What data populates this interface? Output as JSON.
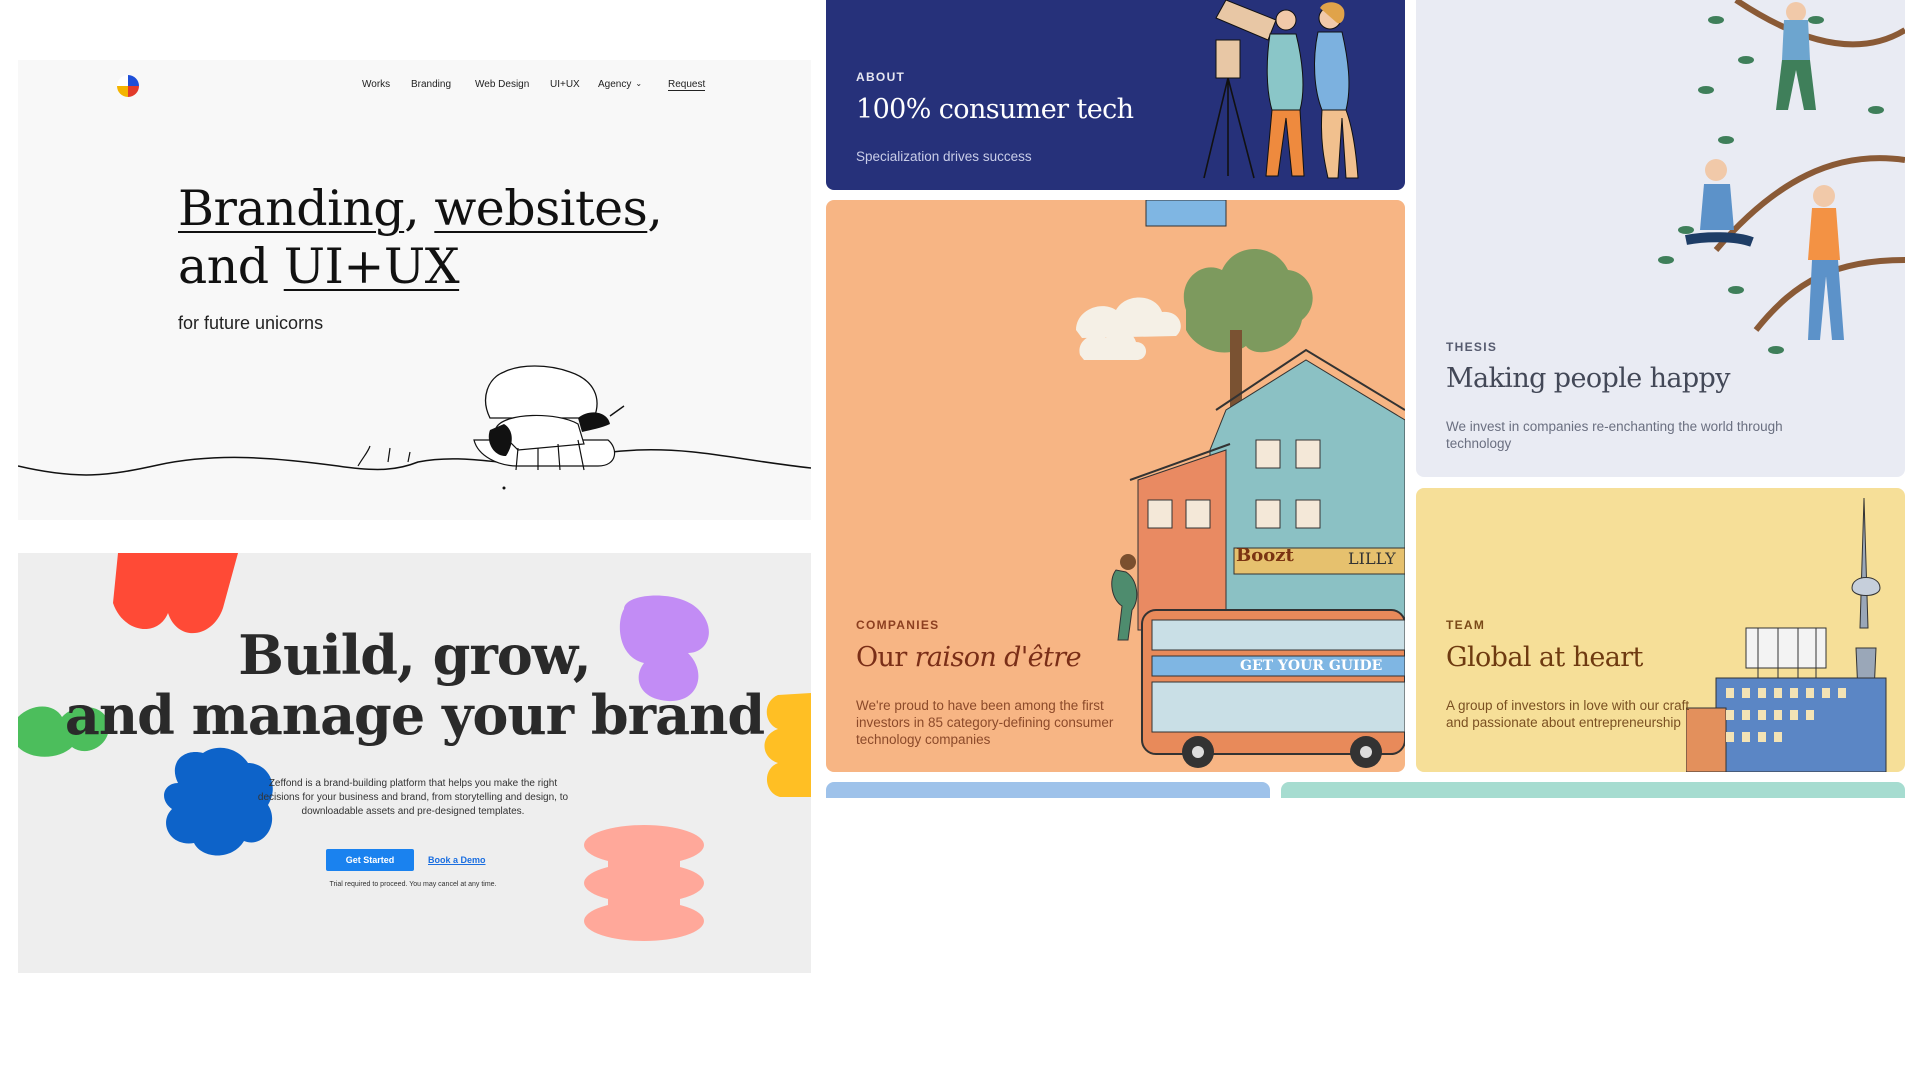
{
  "branding_site": {
    "nav": [
      {
        "label": "Works"
      },
      {
        "label": "Branding"
      },
      {
        "label": "Web Design"
      },
      {
        "label": "UI+UX"
      },
      {
        "label": "Agency"
      },
      {
        "label": "Request"
      }
    ],
    "hero_line1_a": "Branding",
    "hero_line1_sep": ", ",
    "hero_line1_b": "websites",
    "hero_line1_end": ",",
    "hero_line2_a": "and ",
    "hero_line2_b": "UI+UX",
    "subtitle": "for future unicorns"
  },
  "brand_builder": {
    "headline_line1": "Build, grow,",
    "headline_line2": "and manage your brand",
    "description": "Zeffond is a brand-building platform that helps you make the right decisions for your business and brand, from storytelling and design, to downloadable assets and pre-designed templates.",
    "cta_primary": "Get Started",
    "cta_secondary": "Book a Demo",
    "trial_note": "Trial required to proceed. You may cancel at any time."
  },
  "cards": {
    "about": {
      "eyebrow": "ABOUT",
      "title": "100% consumer tech",
      "desc": "Specialization drives success",
      "bg": "#26317a"
    },
    "companies": {
      "eyebrow": "COMPANIES",
      "title_a": "Our ",
      "title_b": "raison d'être",
      "desc": "We're proud to have been among the first investors in 85 category-defining consumer technology companies",
      "bg": "#f7b584",
      "sign1": "Boozt",
      "sign2": "LILLY",
      "sign3": "GET YOUR GUIDE"
    },
    "thesis": {
      "eyebrow": "THESIS",
      "title": "Making people happy",
      "desc": "We invest in companies re-enchanting the world through technology",
      "bg": "#e9ebf3"
    },
    "team": {
      "eyebrow": "TEAM",
      "title": "Global at heart",
      "desc": "A group of investors in love with our craft and passionate about entrepreneurship",
      "bg": "#f6df98"
    }
  },
  "colors": {
    "accent_blue": "#1a82ef",
    "blob_red": "#ff4a36",
    "blob_purple": "#c28cf5",
    "blob_green": "#4cbe5c",
    "blob_blue": "#0d63c9",
    "blob_yellow": "#ffbf24",
    "blob_pink": "#ffa89a"
  }
}
